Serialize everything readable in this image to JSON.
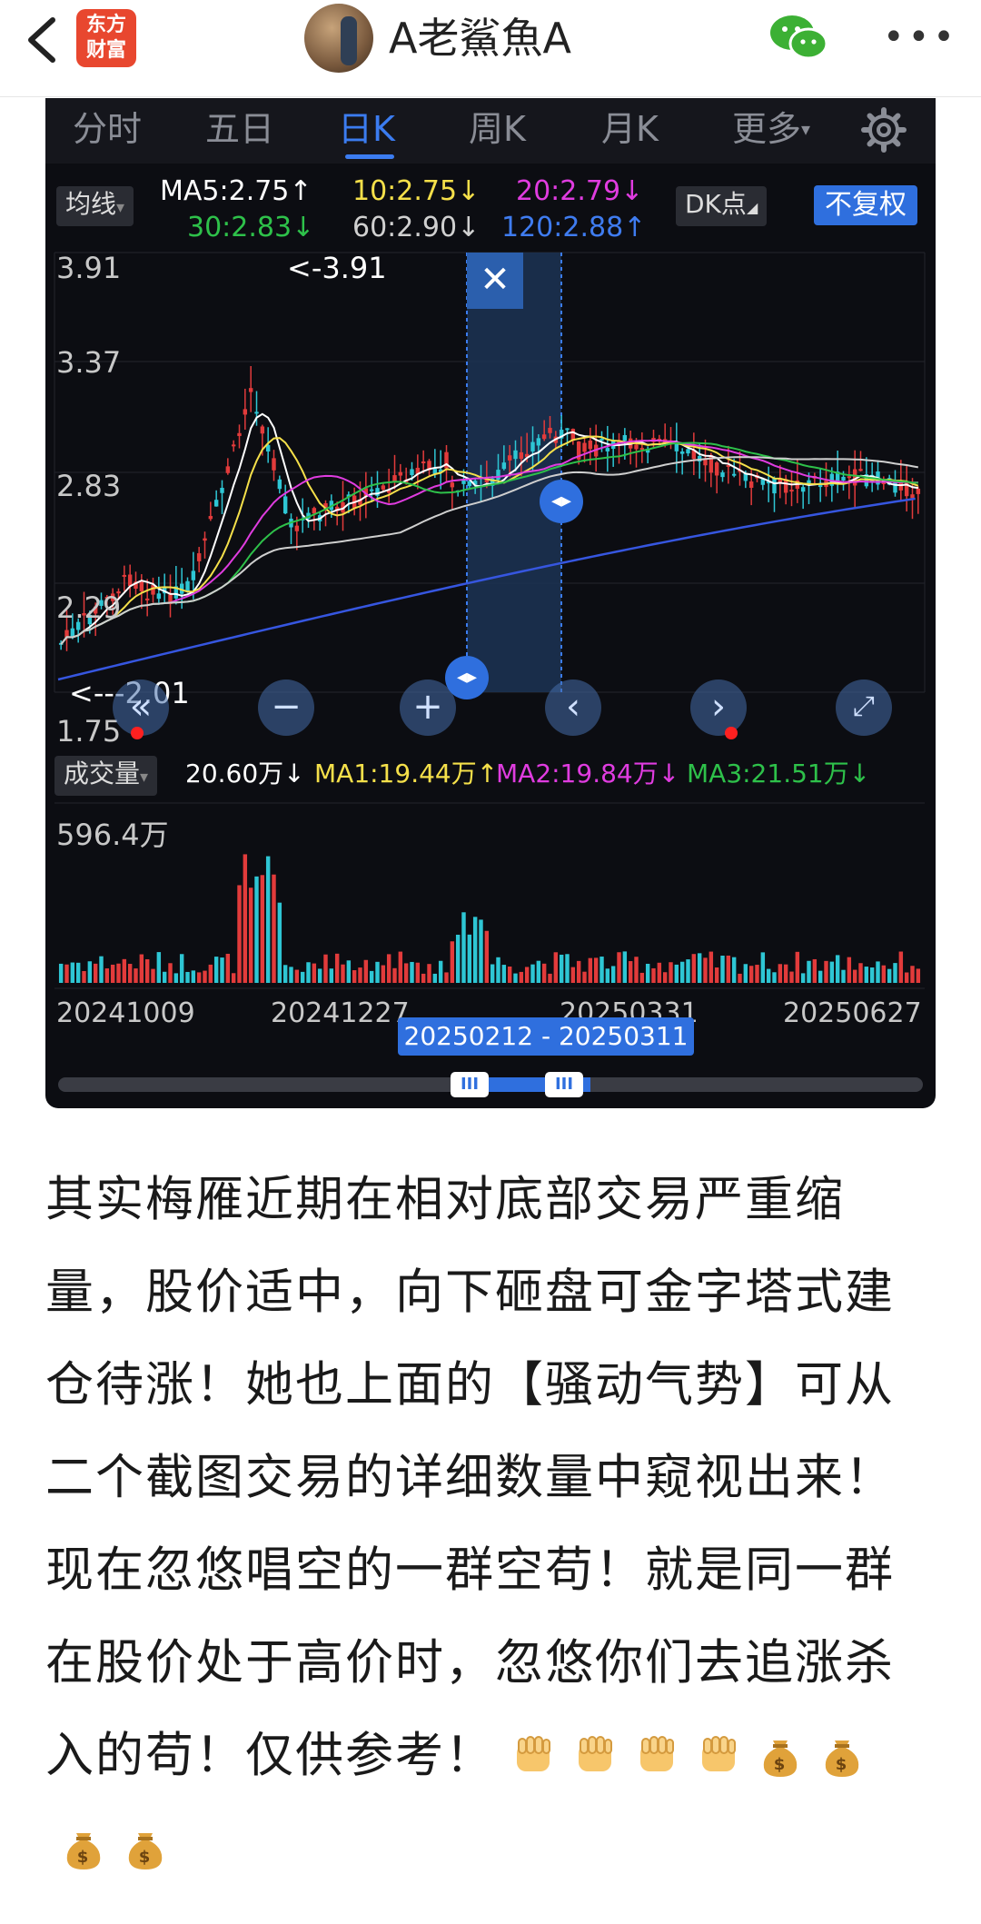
{
  "header": {
    "app_logo_line1": "东方",
    "app_logo_line2": "财富",
    "username": "A老鯊魚A"
  },
  "chart": {
    "tabs": [
      "分时",
      "五日",
      "日K",
      "周K",
      "月K",
      "更多"
    ],
    "active_tab": "日K",
    "ma_chip": "均线",
    "ma5": "MA5:2.75↑",
    "ma10": "10:2.75↓",
    "ma20": "20:2.79↓",
    "ma30": "30:2.83↓",
    "ma60": "60:2.90↓",
    "ma120": "120:2.88↑",
    "dk_chip": "DK点",
    "fq_chip": "不复权",
    "price_labels": [
      "3.91",
      "3.37",
      "2.83",
      "2.29",
      "1.75"
    ],
    "high_annot": "<-3.91",
    "low_annot": "<---2.01",
    "vol_chip": "成交量",
    "vol_value": "20.60万↓",
    "vol_ma1": "MA1:19.44万↑",
    "vol_ma2": "MA2:19.84万↓",
    "vol_ma3": "MA3:21.51万↓",
    "vol_max": "596.4万",
    "dates": [
      "20241009",
      "20241227",
      "20250331",
      "20250627"
    ],
    "range": "20250212 - 20250311",
    "colors": {
      "up": "#e23b3b",
      "down": "#2ec6d4",
      "ma5": "#ffffff",
      "ma10": "#f5e04a",
      "ma20": "#e03ce0",
      "ma30": "#2ec14a",
      "ma60": "#cfcfcf",
      "ma120": "#3656e0",
      "accent": "#2f6fde"
    }
  },
  "post": {
    "text": "其实梅雁近期在相对底部交易严重缩量，股价适中，向下砸盘可金字塔式建仓待涨！她也上面的【骚动气势】可从二个截图交易的详细数量中窥视出来！现在忽悠唱空的一群空苟！就是同一群在股价处于高价时，忽悠你们去追涨杀入的苟！仅供参考！",
    "emojis": [
      "fist-icon",
      "fist-icon",
      "fist-icon",
      "fist-icon",
      "money-bag-icon",
      "money-bag-icon",
      "money-bag-icon",
      "money-bag-icon"
    ]
  }
}
